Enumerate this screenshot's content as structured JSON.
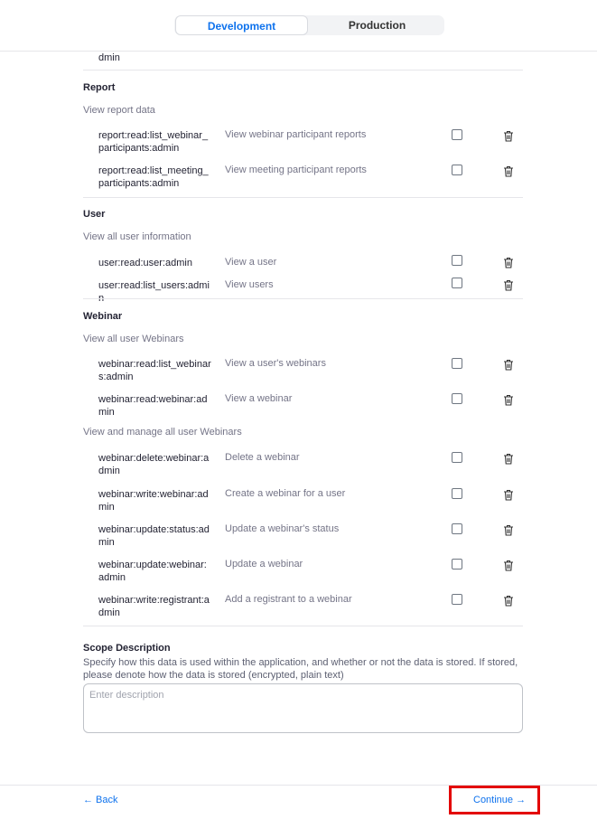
{
  "tabs": {
    "development": "Development",
    "production": "Production"
  },
  "partial_row": "dmin",
  "groups": {
    "report": {
      "title": "Report",
      "subtitle": "View report data",
      "scopes": [
        {
          "name": "report:read:list_webinar_participants:admin",
          "desc": "View webinar participant reports"
        },
        {
          "name": "report:read:list_meeting_participants:admin",
          "desc": "View meeting participant reports"
        }
      ]
    },
    "user": {
      "title": "User",
      "subtitle": "View all user information",
      "scopes": [
        {
          "name": "user:read:user:admin",
          "desc": "View a user"
        },
        {
          "name": "user:read:list_users:admin",
          "desc": "View users"
        }
      ]
    },
    "webinar": {
      "title": "Webinar",
      "subtitle": "View all user Webinars",
      "scopes": [
        {
          "name": "webinar:read:list_webinars:admin",
          "desc": "View a user's webinars"
        },
        {
          "name": "webinar:read:webinar:admin",
          "desc": "View a webinar"
        }
      ],
      "subtitle2": "View and manage all user Webinars",
      "scopes2": [
        {
          "name": "webinar:delete:webinar:admin",
          "desc": "Delete a webinar"
        },
        {
          "name": "webinar:write:webinar:admin",
          "desc": "Create a webinar for a user"
        },
        {
          "name": "webinar:update:status:admin",
          "desc": "Update a webinar's status"
        },
        {
          "name": "webinar:update:webinar:admin",
          "desc": "Update a webinar"
        },
        {
          "name": "webinar:write:registrant:admin",
          "desc": "Add a registrant to a webinar"
        }
      ]
    }
  },
  "scope_description": {
    "title": "Scope Description",
    "help": "Specify how this data is used within the application, and whether or not the data is stored. If stored, please denote how the data is stored (encrypted, plain text)",
    "placeholder": "Enter description"
  },
  "footer": {
    "back": "← Back",
    "continue": "Continue →"
  },
  "colors": {
    "accent": "#0e72ed",
    "highlight": "#e30000"
  }
}
